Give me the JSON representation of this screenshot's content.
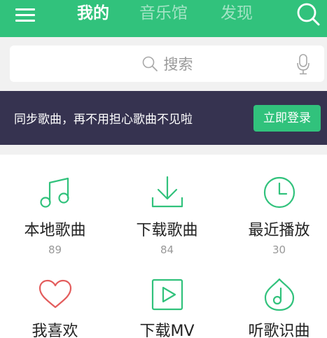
{
  "header": {
    "tabs": [
      {
        "label": "我的",
        "active": true
      },
      {
        "label": "音乐馆",
        "active": false
      },
      {
        "label": "发现",
        "active": false
      }
    ],
    "accent_color": "#31c27c",
    "icons": {
      "menu": "hamburger-menu-icon",
      "search": "search-icon"
    }
  },
  "search": {
    "placeholder": "搜索",
    "icons": {
      "glass": "search-icon",
      "voice": "microphone-icon"
    }
  },
  "login_banner": {
    "text": "同步歌曲，再不用担心歌曲不见啦",
    "button_label": "立即登录",
    "background_color": "#363350"
  },
  "grid": {
    "items": [
      {
        "label": "本地歌曲",
        "count": "89",
        "icon": "music-note-icon"
      },
      {
        "label": "下载歌曲",
        "count": "84",
        "icon": "download-icon"
      },
      {
        "label": "最近播放",
        "count": "30",
        "icon": "clock-icon"
      },
      {
        "label": "我喜欢",
        "icon": "heart-icon"
      },
      {
        "label": "下载MV",
        "icon": "video-play-icon"
      },
      {
        "label": "听歌识曲",
        "icon": "music-recognition-icon"
      }
    ],
    "icon_color": "#31c27c",
    "heart_color": "#e35c5c"
  }
}
